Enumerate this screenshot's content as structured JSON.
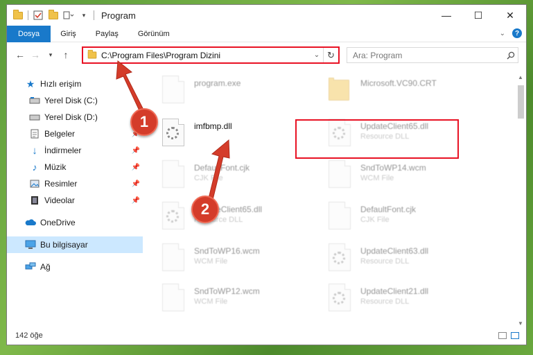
{
  "window": {
    "title": "Program",
    "controls": [
      "minimize",
      "maximize",
      "close"
    ]
  },
  "ribbon": {
    "tabs": [
      "Dosya",
      "Giriş",
      "Paylaş",
      "Görünüm"
    ]
  },
  "address": {
    "path": "C:\\Program Files\\Program Dizini"
  },
  "search": {
    "placeholder": "Ara: Program"
  },
  "sidebar": {
    "items": [
      {
        "label": "Hızlı erişim",
        "icon": "star-icon"
      },
      {
        "label": "Yerel Disk (C:)",
        "icon": "drive-icon"
      },
      {
        "label": "Yerel Disk (D:)",
        "icon": "drive-icon"
      },
      {
        "label": "Belgeler",
        "icon": "documents-icon"
      },
      {
        "label": "İndirmeler",
        "icon": "download-icon"
      },
      {
        "label": "Müzik",
        "icon": "music-icon"
      },
      {
        "label": "Resimler",
        "icon": "pictures-icon"
      },
      {
        "label": "Videolar",
        "icon": "video-icon"
      },
      {
        "label": "OneDrive",
        "icon": "cloud-icon"
      },
      {
        "label": "Bu bilgisayar",
        "icon": "computer-icon"
      },
      {
        "label": "Ağ",
        "icon": "network-icon"
      }
    ]
  },
  "files": [
    {
      "name": "program.exe",
      "type": ""
    },
    {
      "name": "Microsoft.VC90.CRT",
      "type": ""
    },
    {
      "name": "imfbmp.dll",
      "type": ""
    },
    {
      "name": "UpdateClient65.dll",
      "type": "Resource DLL"
    },
    {
      "name": "DefaultFont.cjk",
      "type": "CJK File"
    },
    {
      "name": "SndToWP14.wcm",
      "type": "WCM File"
    },
    {
      "name": "UpdateClient65.dll",
      "type": "Resource DLL"
    },
    {
      "name": "DefaultFont.cjk",
      "type": "CJK File"
    },
    {
      "name": "SndToWP16.wcm",
      "type": "WCM File"
    },
    {
      "name": "UpdateClient63.dll",
      "type": "Resource DLL"
    },
    {
      "name": "SndToWP12.wcm",
      "type": "WCM File"
    },
    {
      "name": "UpdateClient21.dll",
      "type": "Resource DLL"
    }
  ],
  "status": {
    "count": "142 öğe"
  },
  "annotations": {
    "step1": "1",
    "step2": "2",
    "color": "#d43c2a"
  }
}
